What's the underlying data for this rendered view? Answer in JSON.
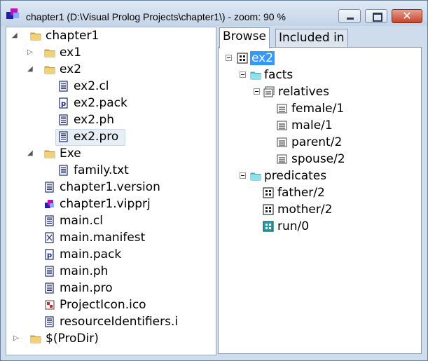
{
  "window": {
    "title": "chapter1 (D:\\Visual Prolog Projects\\chapter1\\) - zoom: 90 %",
    "close_glyph": "✕"
  },
  "project_tree": {
    "root": "chapter1",
    "ex1": "ex1",
    "ex2": "ex2",
    "ex2_children": [
      "ex2.cl",
      "ex2.pack",
      "ex2.ph",
      "ex2.pro"
    ],
    "exe": "Exe",
    "exe_children": [
      "family.txt"
    ],
    "files": [
      "chapter1.version",
      "chapter1.vipprj",
      "main.cl",
      "main.manifest",
      "main.pack",
      "main.ph",
      "main.pro",
      "ProjectIcon.ico",
      "resourceIdentifiers.i"
    ],
    "prodir": "$(ProDir)"
  },
  "tabs": {
    "browse": "Browse",
    "included_in": "Included in"
  },
  "browse_tree": {
    "root": "ex2",
    "facts": "facts",
    "relatives": "relatives",
    "relatives_items": [
      "female/1",
      "male/1",
      "parent/2",
      "spouse/2"
    ],
    "predicates": "predicates",
    "predicates_items": [
      "father/2",
      "mother/2",
      "run/0"
    ]
  },
  "colors": {
    "folder": "#e0b84c",
    "selection": "#3399ff",
    "pane_bg": "#cfdceb"
  }
}
